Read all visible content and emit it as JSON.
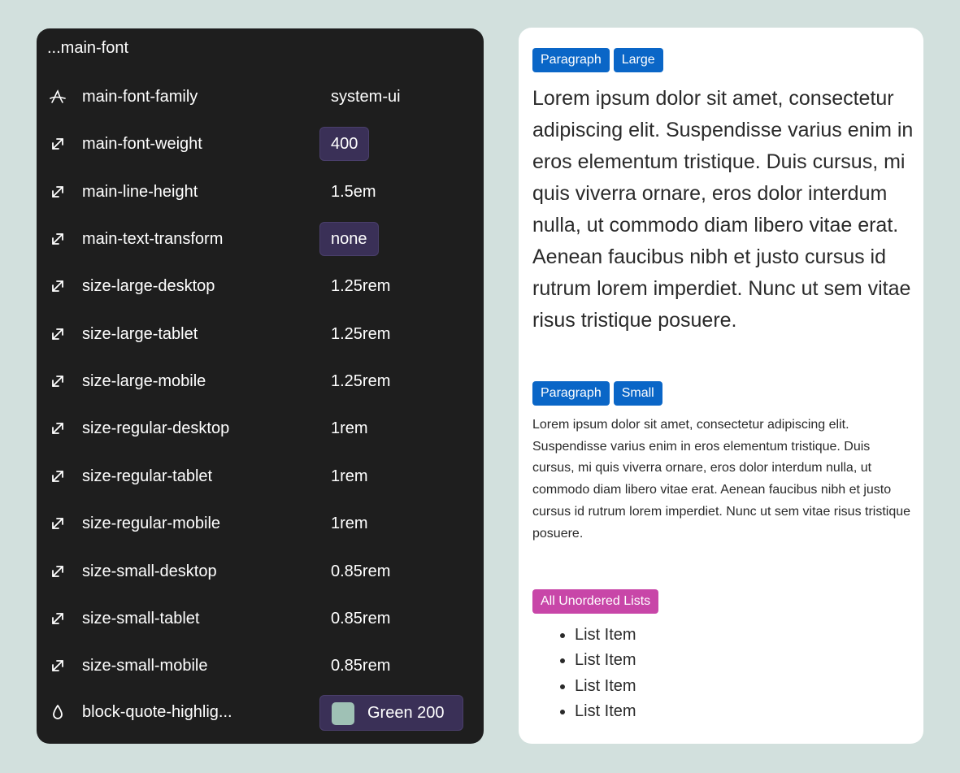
{
  "variables_panel": {
    "title": "...main-font",
    "rows": [
      {
        "icon": "font-family-icon",
        "name": "main-font-family",
        "value": "system-ui",
        "chip": false
      },
      {
        "icon": "resize-arrow-icon",
        "name": "main-font-weight",
        "value": "400",
        "chip": true
      },
      {
        "icon": "resize-arrow-icon",
        "name": "main-line-height",
        "value": "1.5em",
        "chip": false
      },
      {
        "icon": "resize-arrow-icon",
        "name": "main-text-transform",
        "value": "none",
        "chip": true
      },
      {
        "icon": "resize-arrow-icon",
        "name": "size-large-desktop",
        "value": "1.25rem",
        "chip": false
      },
      {
        "icon": "resize-arrow-icon",
        "name": "size-large-tablet",
        "value": "1.25rem",
        "chip": false
      },
      {
        "icon": "resize-arrow-icon",
        "name": "size-large-mobile",
        "value": "1.25rem",
        "chip": false
      },
      {
        "icon": "resize-arrow-icon",
        "name": "size-regular-desktop",
        "value": "1rem",
        "chip": false
      },
      {
        "icon": "resize-arrow-icon",
        "name": "size-regular-tablet",
        "value": "1rem",
        "chip": false
      },
      {
        "icon": "resize-arrow-icon",
        "name": "size-regular-mobile",
        "value": "1rem",
        "chip": false
      },
      {
        "icon": "resize-arrow-icon",
        "name": "size-small-desktop",
        "value": "0.85rem",
        "chip": false
      },
      {
        "icon": "resize-arrow-icon",
        "name": "size-small-tablet",
        "value": "0.85rem",
        "chip": false
      },
      {
        "icon": "resize-arrow-icon",
        "name": "size-small-mobile",
        "value": "0.85rem",
        "chip": false
      }
    ],
    "color_row": {
      "icon": "droplet-icon",
      "name": "block-quote-highlig...",
      "value": "Green 200",
      "swatch_color": "#9fc1b5"
    }
  },
  "preview": {
    "large_tags": [
      "Paragraph",
      "Large"
    ],
    "large_paragraph": "Lorem ipsum dolor sit amet, consectetur adipiscing elit. Suspendisse varius enim in eros elementum tristique. Duis cursus, mi quis viverra ornare, eros dolor interdum nulla, ut commodo diam libero vitae erat. Aenean faucibus nibh et justo cursus id rutrum lorem imperdiet. Nunc ut sem vitae risus tristique posuere.",
    "small_tags": [
      "Paragraph",
      "Small"
    ],
    "small_paragraph": "Lorem ipsum dolor sit amet, consectetur adipiscing elit. Suspendisse varius enim in eros elementum tristique. Duis cursus, mi quis viverra ornare, eros dolor interdum nulla, ut commodo diam libero vitae erat. Aenean faucibus nibh et justo cursus id rutrum lorem imperdiet. Nunc ut sem vitae risus tristique posuere.",
    "list_tag": "All Unordered Lists",
    "list_items": [
      "List Item",
      "List Item",
      "List Item",
      "List Item"
    ]
  },
  "colors": {
    "background": "#d2e0dd",
    "dark_panel": "#1e1e1e",
    "chip": "#3a3057",
    "tag_blue": "#0a66c7",
    "tag_pink": "#c846a8"
  }
}
